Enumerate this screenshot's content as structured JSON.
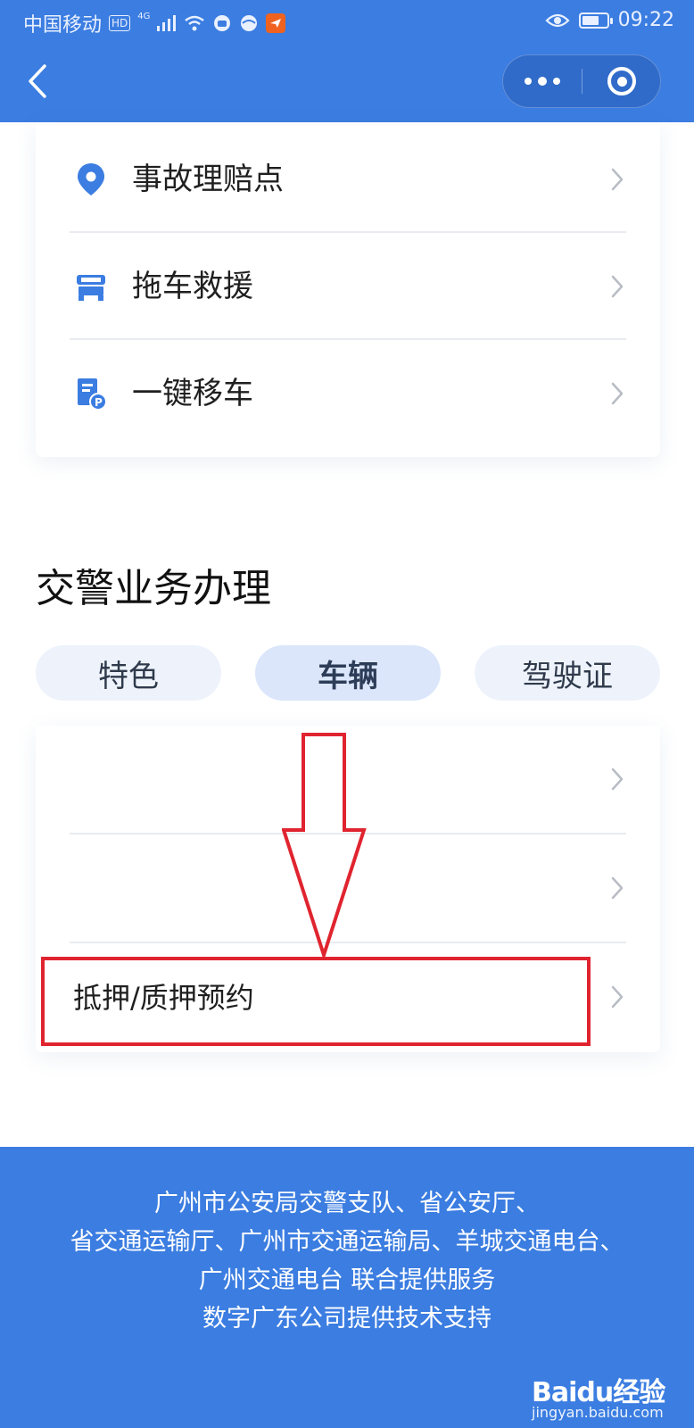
{
  "status_bar": {
    "carrier": "中国移动",
    "hd": "HD",
    "network": "4G",
    "time": "09:22"
  },
  "nav": {
    "back_icon": "chevron-left-icon",
    "more_icon": "more-dots-icon",
    "close_icon": "target-close-icon"
  },
  "quick_services": [
    {
      "label": "事故理赔点",
      "icon": "location-pin-icon"
    },
    {
      "label": "拖车救援",
      "icon": "tow-truck-icon"
    },
    {
      "label": "一键移车",
      "icon": "parking-doc-icon"
    }
  ],
  "section": {
    "title": "交警业务办理",
    "tabs": [
      {
        "label": "特色",
        "active": false
      },
      {
        "label": "车辆",
        "active": true
      },
      {
        "label": "驾驶证",
        "active": false
      }
    ]
  },
  "vehicle_items": [
    {
      "label": ""
    },
    {
      "label": ""
    },
    {
      "label": "抵押/质押预约"
    }
  ],
  "footer": {
    "lines": [
      "广州市公安局交警支队、省公安厅、",
      "省交通运输厅、广州市交通运输局、羊城交通电台、",
      "广州交通电台 联合提供服务",
      "数字广东公司提供技术支持"
    ]
  },
  "watermark": {
    "brand": "Baidu经验",
    "url": "jingyan.baidu.com"
  },
  "colors": {
    "brand_blue": "#3b7de1",
    "highlight_red": "#e0242f",
    "tab_bg": "#eef3fb",
    "tab_active_bg": "#dbe6fb"
  }
}
